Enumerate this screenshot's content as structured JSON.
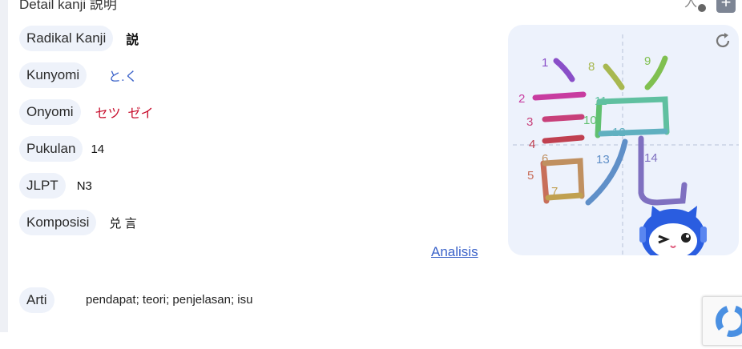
{
  "header": {
    "title": "Detail kanji 説明"
  },
  "details": {
    "radikal": {
      "label": "Radikal Kanji",
      "value": "説"
    },
    "kunyomi": {
      "label": "Kunyomi",
      "value": "と.く"
    },
    "onyomi": {
      "label": "Onyomi",
      "value": "セツ  ゼイ"
    },
    "pukulan": {
      "label": "Pukulan",
      "value": "14"
    },
    "jlpt": {
      "label": "JLPT",
      "value": "N3"
    },
    "komposisi": {
      "label": "Komposisi",
      "value": "兑 言"
    }
  },
  "analisis_link": "Analisis",
  "arti": {
    "label": "Arti",
    "value": "pendapat; teori; penjelasan; isu"
  },
  "stroke_numbers": [
    "1",
    "2",
    "3",
    "4",
    "5",
    "6",
    "7",
    "8",
    "9",
    "10",
    "11",
    "12",
    "13",
    "14"
  ],
  "colors": {
    "pill_bg": "#eef2fa",
    "link_blue": "#3a62c9",
    "onyomi_red": "#c8102e",
    "panel_bg": "#edf2fc"
  }
}
